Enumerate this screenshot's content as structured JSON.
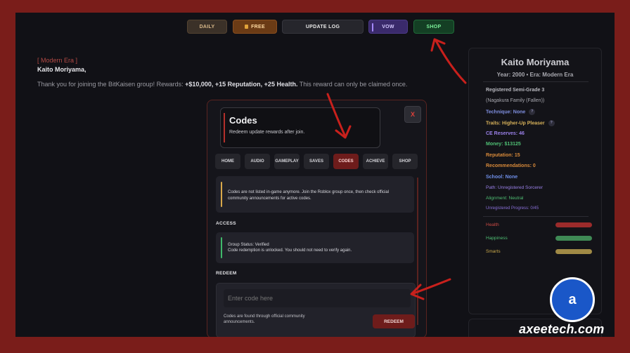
{
  "nav": {
    "daily": "DAILY",
    "free": "FREE",
    "free_icon": "gift-icon",
    "update_log": "UPDATE LOG",
    "vow": "VOW",
    "shop": "SHOP"
  },
  "message": {
    "era_tag": "[ Modern Era ]",
    "greeting": "Kaito Moriyama,",
    "body_prefix": "Thank you for joining the BitKaisen group! Rewards: ",
    "rewards": "+$10,000, +15 Reputation, +25 Health.",
    "body_suffix": " This reward can only be claimed once."
  },
  "modal": {
    "title": "Codes",
    "subtitle": "Redeem update rewards after join.",
    "close_label": "X",
    "tabs": [
      "HOME",
      "AUDIO",
      "GAMEPLAY",
      "SAVES",
      "CODES",
      "ACHIEVE",
      "SHOP"
    ],
    "active_tab": "CODES",
    "info_text": "Codes are not listed in-game anymore. Join the Roblox group once, then check official community announcements for active codes.",
    "access_heading": "ACCESS",
    "access_line1": "Group Status: Verified",
    "access_line2": "Code redemption is unlocked. You should not need to verify again.",
    "redeem_heading": "REDEEM",
    "code_placeholder": "Enter code here",
    "hint": "Codes are found through official community announcements.",
    "redeem_button": "REDEEM"
  },
  "profile": {
    "name": "Kaito Moriyama",
    "meta": "Year: 2000  •  Era: Modern Era",
    "rank": "Registered Semi-Grade 3",
    "family": "(Nagakura Family (Fallen))",
    "technique": "Technique: None",
    "traits": "Traits: Higher-Up Pleaser",
    "ce_reserves": "CE Reserves: 46",
    "money": "Money: $13125",
    "reputation": "Reputation: 15",
    "recommendations": "Recommendations: 0",
    "school": "School: None",
    "path": "Path: Unregistered Sorcerer",
    "alignment": "Alignment: Neutral",
    "progress": "Unregistered Progress: 0/45",
    "help_icon": "?",
    "stats": [
      {
        "label": "Health",
        "level": 1.0,
        "color": "#9b2b2b"
      },
      {
        "label": "Happiness",
        "level": 1.0,
        "color": "#3f8a55"
      },
      {
        "label": "Smarts",
        "level": 1.0,
        "color": "#a08a45"
      }
    ]
  },
  "watermark": {
    "logo_text": "a",
    "site": "axeetech.com"
  },
  "colors": {
    "frame_border": "#7a1d1a",
    "accent_red": "#b3302b",
    "shop_green": "#7cf29a",
    "vow_purple": "#a488ff"
  }
}
